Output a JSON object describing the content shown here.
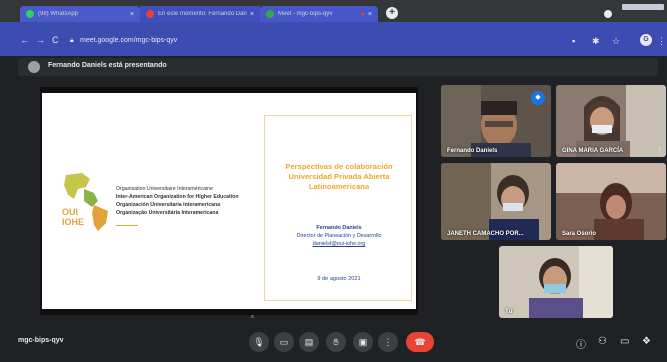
{
  "browser": {
    "tabs": [
      {
        "label": "(98) WhatsApp",
        "favicon_color": "#25d366"
      },
      {
        "label": "En este momento: Fernando Dan...",
        "favicon_color": "#ea4335"
      },
      {
        "label": "Meet - mgc-bips-qyv",
        "favicon_color": "#34a853"
      }
    ],
    "new_tab_icon": "+",
    "url": "meet.google.com/mgc-bips-qyv"
  },
  "presenting_banner": "Fernando Daniels está presentando",
  "slide": {
    "logo_text_1": "OUI",
    "logo_text_2": "IOHE",
    "organizations": [
      "Organisation Universitaire Interaméricaine",
      "Inter-American Organization for Higher Education",
      "Organización Universitaria Interamericana",
      "Organização Universitária Interamericana"
    ],
    "title": "Perspectivas de colaboración Universidad Privada Abierta Latinoamericana",
    "speaker_name": "Fernando Daniels",
    "speaker_role": "Director de Planeación y Desarrollo",
    "speaker_email": "danielsf@oui-iohe.org",
    "date": "9 de agosto 2021"
  },
  "participants": [
    {
      "name": "Fernando Daniels",
      "bg": "#4a3f35",
      "speaking": true
    },
    {
      "name": "GINA MARIA GARCÍA",
      "bg": "#6c5a50"
    },
    {
      "name": "JANETH CAMACHO POR...",
      "bg": "#5b5048"
    },
    {
      "name": "Sara Osorio",
      "bg": "#5a4236"
    },
    {
      "name": "Tú",
      "bg": "#c7c0b6"
    }
  ],
  "meeting_code": "mgc-bips-qyv",
  "colors": {
    "meet_dark": "#202124",
    "browser_bar": "#3c4cb1",
    "end_call": "#ea4335",
    "slide_title": "#f0a72a",
    "slide_text": "#27438a"
  }
}
